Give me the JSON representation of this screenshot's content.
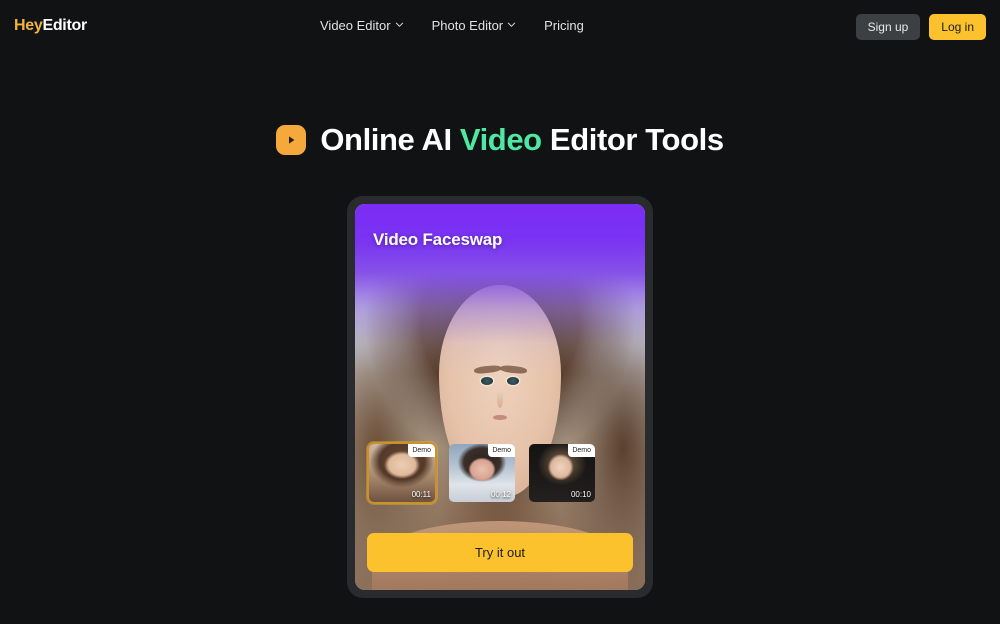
{
  "header": {
    "logo": {
      "part1": "Hey",
      "part2": "Editor"
    },
    "nav": [
      {
        "label": "Video Editor",
        "has_chevron": true,
        "icon": "chevron-down-icon"
      },
      {
        "label": "Photo Editor",
        "has_chevron": true,
        "icon": "chevron-down-icon"
      },
      {
        "label": "Pricing",
        "has_chevron": false,
        "icon": ""
      }
    ],
    "signup_label": "Sign up",
    "login_label": "Log in"
  },
  "hero": {
    "icon": "play-badge-icon",
    "title_part1": "Online AI ",
    "title_accent": "Video",
    "title_part2": " Editor Tools"
  },
  "card": {
    "title": "Video Faceswap",
    "cta_label": "Try it out",
    "thumbnails": [
      {
        "badge": "Demo",
        "duration": "00:11",
        "selected": true
      },
      {
        "badge": "Demo",
        "duration": "00:12",
        "selected": false
      },
      {
        "badge": "Demo",
        "duration": "00:10",
        "selected": false
      }
    ]
  },
  "colors": {
    "background": "#101214",
    "brand_yellow": "#F2B33D",
    "button_yellow": "#FBC22E",
    "accent_green": "#4EE8A4",
    "play_orange": "#F5A83C",
    "card_frame": "#2a2b2e",
    "signup_gray": "#3d4043",
    "purple_top": "#7B2BF5"
  }
}
